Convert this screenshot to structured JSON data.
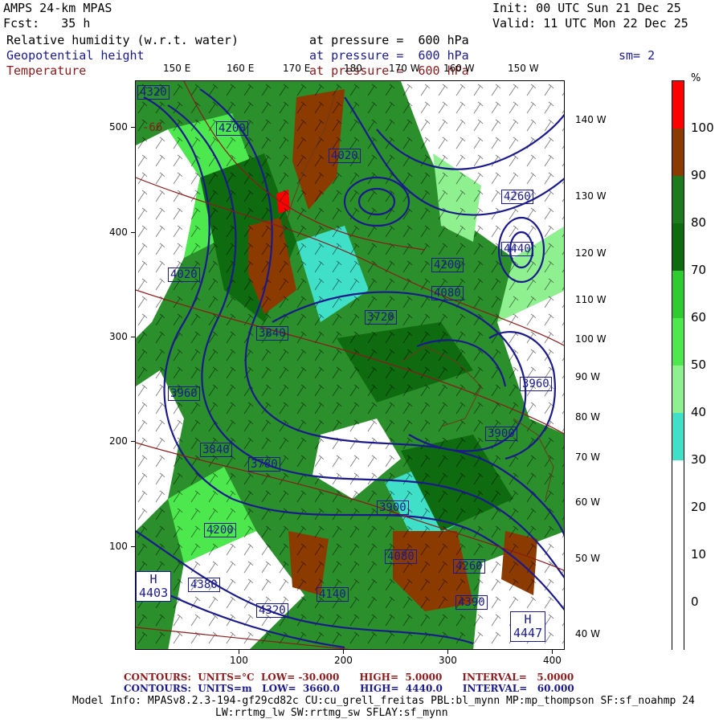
{
  "header": {
    "model": "AMPS 24-km MPAS",
    "init": "Init: 00 UTC Sun 21 Dec 25",
    "fcst": "Fcst:   35 h",
    "valid": "Valid: 11 UTC Mon 22 Dec 25",
    "var1": "Relative humidity (w.r.t. water)",
    "var1_level": "at pressure =  600 hPa",
    "var2": "Geopotential height",
    "var2_level": "at pressure =  600 hPa",
    "smooth": "sm= 2",
    "var3": "Temperature",
    "var3_level": "at pressure =  600 hPa"
  },
  "map": {
    "top_longitudes": [
      "150 E",
      "160 E",
      "170 E",
      "180",
      "170 W",
      "160 W",
      "150 W"
    ],
    "right_longitudes": [
      "140 W",
      "130 W",
      "120 W",
      "110 W",
      "100 W",
      "90 W",
      "80 W",
      "70 W",
      "60 W",
      "50 W",
      "40 W"
    ],
    "y_ticks": [
      "500",
      "400",
      "300",
      "200",
      "100"
    ],
    "x_ticks": [
      "100",
      "200",
      "300",
      "400"
    ],
    "height_labels": [
      "4320",
      "4200",
      "4020",
      "3960",
      "3840",
      "3780",
      "3900",
      "4080",
      "4140",
      "4260",
      "4380",
      "4200",
      "3840",
      "3720",
      "3900",
      "3960",
      "4080",
      "4020",
      "4260",
      "4320",
      "4390",
      "4200",
      "4440"
    ],
    "high_labels": [
      {
        "symbol": "H",
        "value": "4403"
      },
      {
        "symbol": "H",
        "value": "4447"
      }
    ],
    "temp_label": "-66"
  },
  "colorbar": {
    "unit": "%",
    "labels": [
      "100",
      "90",
      "80",
      "70",
      "60",
      "50",
      "40",
      "30",
      "20",
      "10",
      "0"
    ],
    "colors": [
      "#ff0000",
      "#8b3a00",
      "#1e7a1e",
      "#0f6b0f",
      "#2ecc2e",
      "#4de84d",
      "#8ff08f",
      "#40e0c8",
      "#ffffff",
      "#ffffff",
      "#ffffff",
      "#ffffff"
    ]
  },
  "footer": {
    "contours_t": "CONTOURS:  UNITS=°C  LOW= -30.000      HIGH=  5.0000      INTERVAL=   5.0000",
    "contours_z": "CONTOURS:  UNITS=m   LOW=  3660.0      HIGH=  4440.0      INTERVAL=   60.000",
    "model_info": "Model Info: MPASv8.2.3-194-gf29cd82c CU:cu_grell_freitas PBL:bl_mynn MP:mp_thompson SF:sf_noahmp 24",
    "model_info2": "LW:rrtmg_lw SW:rrtmg_sw SFLAY:sf_mynn"
  }
}
